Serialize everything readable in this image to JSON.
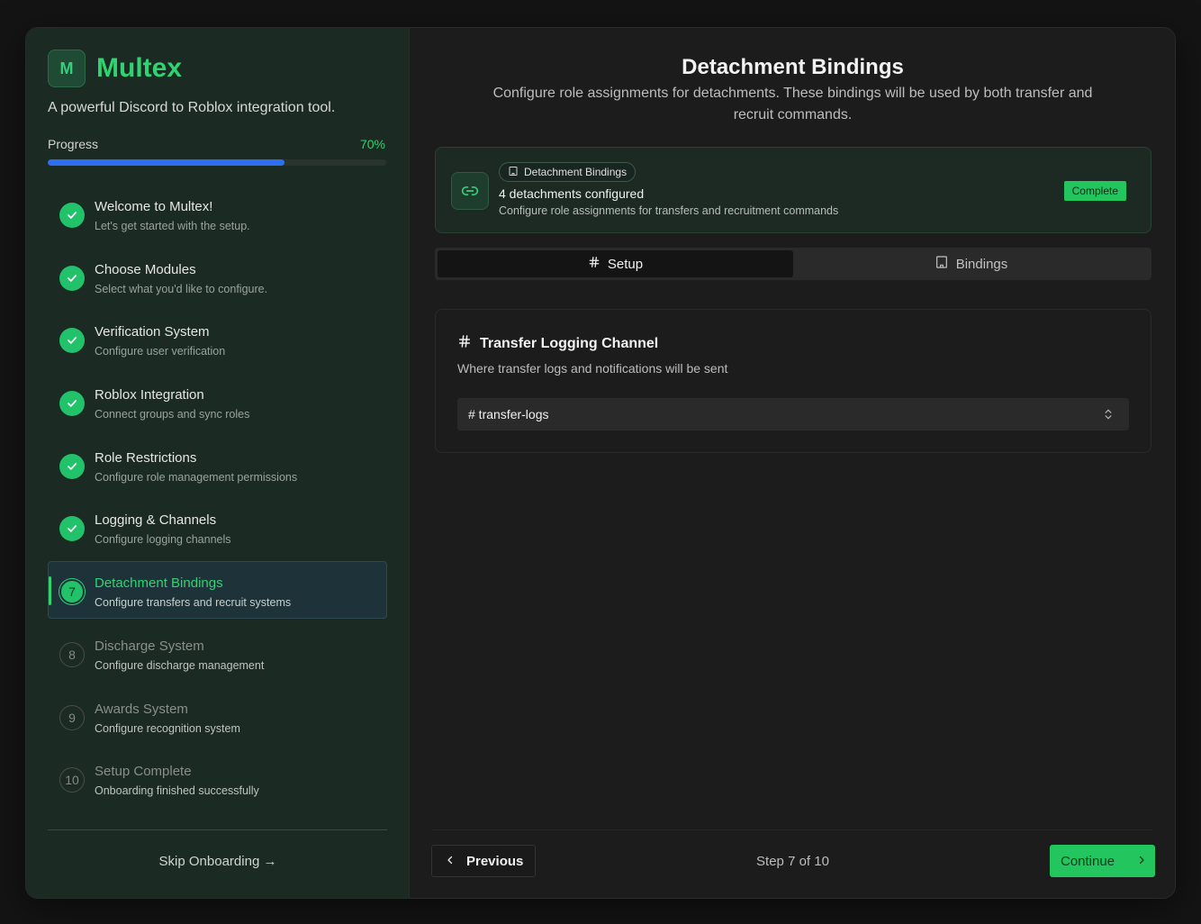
{
  "brand": {
    "logo_letter": "M",
    "name": "Multex",
    "tagline": "A powerful Discord to Roblox integration tool."
  },
  "progress": {
    "label": "Progress",
    "percent_text": "70%",
    "value": 0.7
  },
  "steps": [
    {
      "status": "done",
      "marker": "",
      "title": "Welcome to Multex!",
      "subtitle": "Let's get started with the setup."
    },
    {
      "status": "done",
      "marker": "",
      "title": "Choose Modules",
      "subtitle": "Select what you'd like to configure."
    },
    {
      "status": "done",
      "marker": "",
      "title": "Verification System",
      "subtitle": "Configure user verification"
    },
    {
      "status": "done",
      "marker": "",
      "title": "Roblox Integration",
      "subtitle": "Connect groups and sync roles"
    },
    {
      "status": "done",
      "marker": "",
      "title": "Role Restrictions",
      "subtitle": "Configure role management permissions"
    },
    {
      "status": "done",
      "marker": "",
      "title": "Logging & Channels",
      "subtitle": "Configure logging channels"
    },
    {
      "status": "current",
      "marker": "7",
      "title": "Detachment Bindings",
      "subtitle": "Configure transfers and recruit systems"
    },
    {
      "status": "pending",
      "marker": "8",
      "title": "Discharge System",
      "subtitle": "Configure discharge management"
    },
    {
      "status": "pending",
      "marker": "9",
      "title": "Awards System",
      "subtitle": "Configure recognition system"
    },
    {
      "status": "pending",
      "marker": "10",
      "title": "Setup Complete",
      "subtitle": "Onboarding finished successfully"
    }
  ],
  "sidebar_footer": {
    "skip_label": "Skip Onboarding →"
  },
  "main": {
    "title": "Detachment Bindings",
    "description": "Configure role assignments for detachments. These bindings will be used by both transfer and recruit commands.",
    "summary": {
      "chip_label": "Detachment Bindings",
      "count_text": "4 detachments configured",
      "description": "Configure role assignments for transfers and recruitment commands",
      "badge": "Complete"
    },
    "tabs": [
      {
        "label": "Setup",
        "icon": "hash-icon",
        "selected": true
      },
      {
        "label": "Bindings",
        "icon": "building-icon",
        "selected": false
      }
    ],
    "channel_card": {
      "title": "Transfer Logging Channel",
      "description": "Where transfer logs and notifications will be sent",
      "selected_value": "# transfer-logs"
    },
    "footer": {
      "previous_label": "Previous",
      "step_text": "Step 7 of 10",
      "continue_label": "Continue"
    }
  },
  "colors": {
    "accent_green": "#22c55e",
    "progress_blue": "#2d6ff0",
    "sidebar_bg": "#1b2a22"
  }
}
